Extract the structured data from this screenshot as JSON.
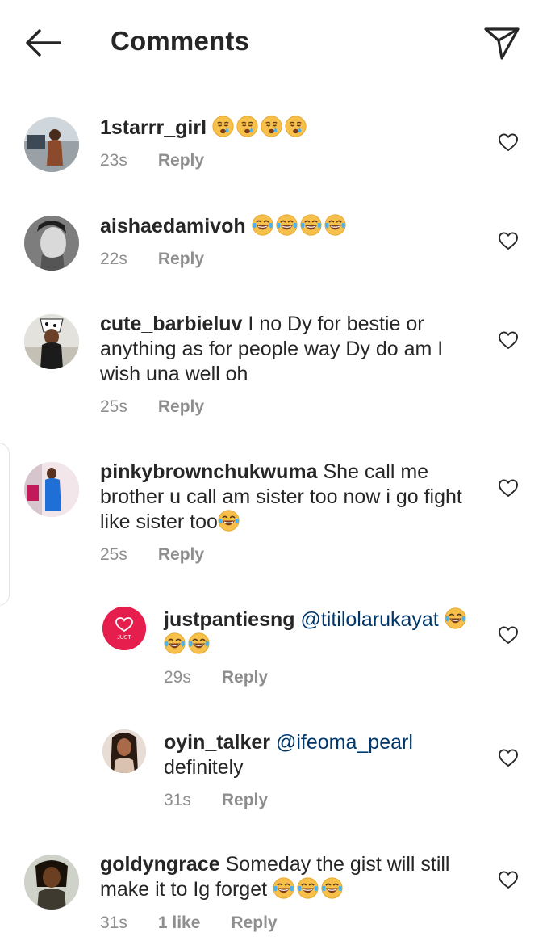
{
  "header": {
    "title": "Comments",
    "back_icon": "arrow-left-icon",
    "send_icon": "paper-plane-icon"
  },
  "colors": {
    "text": "#262626",
    "secondary": "#8e8e8e",
    "mention": "#00376b",
    "emoji_face": "#f7c04a"
  },
  "comments": [
    {
      "username": "1starrr_girl",
      "text": "",
      "emoji": "crying-face-icon",
      "emoji_count": 4,
      "time": "23s",
      "likes": "",
      "reply": "Reply"
    },
    {
      "username": "aishaedamivoh",
      "text": "",
      "emoji": "tears-of-joy-icon",
      "emoji_count": 4,
      "time": "22s",
      "likes": "",
      "reply": "Reply"
    },
    {
      "username": "cute_barbieluv",
      "text": "I no Dy for bestie or anything as for people way Dy do am I wish una well oh",
      "time": "25s",
      "likes": "",
      "reply": "Reply"
    },
    {
      "username": "pinkybrownchukwuma",
      "text": "She call me brother u call am sister too now i go fight like sister too",
      "emoji": "tears-of-joy-icon",
      "emoji_count": 1,
      "time": "25s",
      "likes": "",
      "reply": "Reply"
    },
    {
      "username": "justpantiesng",
      "mention": "@titilolarukayat",
      "text": "",
      "emoji": "tears-of-joy-icon",
      "emoji_count": 3,
      "time": "29s",
      "likes": "",
      "reply": "Reply",
      "avatar_text": "JUST"
    },
    {
      "username": "oyin_talker",
      "mention": "@ifeoma_pearl",
      "text": "definitely",
      "time": "31s",
      "likes": "",
      "reply": "Reply"
    },
    {
      "username": "goldyngrace",
      "text": "Someday the gist will still make it to Ig forget",
      "emoji": "tears-of-joy-icon",
      "emoji_count": 3,
      "time": "31s",
      "likes": "1 like",
      "reply": "Reply"
    }
  ]
}
